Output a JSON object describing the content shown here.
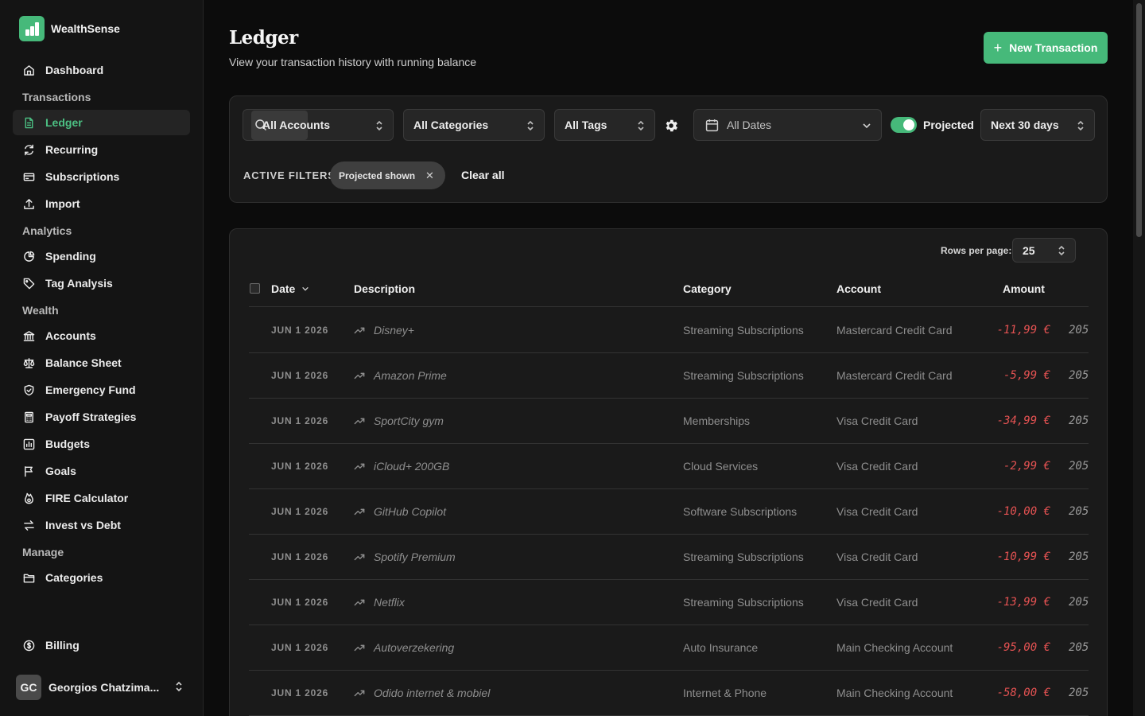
{
  "app": {
    "name": "WealthSense"
  },
  "sidebar": {
    "items": [
      {
        "type": "item",
        "label": "Dashboard",
        "icon": "home-icon"
      },
      {
        "type": "section",
        "label": "Transactions"
      },
      {
        "type": "item",
        "label": "Ledger",
        "icon": "file-text-icon",
        "active": true
      },
      {
        "type": "item",
        "label": "Recurring",
        "icon": "refresh-icon"
      },
      {
        "type": "item",
        "label": "Subscriptions",
        "icon": "credit-card-icon"
      },
      {
        "type": "item",
        "label": "Import",
        "icon": "upload-icon"
      },
      {
        "type": "section",
        "label": "Analytics"
      },
      {
        "type": "item",
        "label": "Spending",
        "icon": "pie-chart-icon"
      },
      {
        "type": "item",
        "label": "Tag Analysis",
        "icon": "tag-icon"
      },
      {
        "type": "section",
        "label": "Wealth"
      },
      {
        "type": "item",
        "label": "Accounts",
        "icon": "bank-icon"
      },
      {
        "type": "item",
        "label": "Balance Sheet",
        "icon": "scale-icon"
      },
      {
        "type": "item",
        "label": "Emergency Fund",
        "icon": "shield-icon"
      },
      {
        "type": "item",
        "label": "Payoff Strategies",
        "icon": "calculator-icon"
      },
      {
        "type": "item",
        "label": "Budgets",
        "icon": "chart-box-icon"
      },
      {
        "type": "item",
        "label": "Goals",
        "icon": "flag-icon"
      },
      {
        "type": "item",
        "label": "FIRE Calculator",
        "icon": "flame-icon"
      },
      {
        "type": "item",
        "label": "Invest vs Debt",
        "icon": "arrows-swap-icon"
      },
      {
        "type": "section",
        "label": "Manage"
      },
      {
        "type": "item",
        "label": "Categories",
        "icon": "folder-icon"
      }
    ],
    "billing": "Billing",
    "user": {
      "initials": "GC",
      "name": "Georgios Chatzima..."
    }
  },
  "page": {
    "title": "Ledger",
    "subtitle": "View your transaction history with running balance",
    "new_button": "New Transaction"
  },
  "filters": {
    "accounts": "All Accounts",
    "categories": "All Categories",
    "tags": "All Tags",
    "dates": "All Dates",
    "projected_label": "Projected",
    "projected_on": true,
    "range": "Next 30 days",
    "active_label": "ACTIVE FILTERS:",
    "chip": "Projected shown",
    "clear": "Clear all"
  },
  "table": {
    "rows_per_page_label": "Rows per page:",
    "rows_per_page": "25",
    "headers": {
      "date": "Date",
      "description": "Description",
      "category": "Category",
      "account": "Account",
      "amount": "Amount"
    },
    "rows": [
      {
        "date": "JUN 1 2026",
        "description": "Disney+",
        "category": "Streaming Subscriptions",
        "account": "Mastercard Credit Card",
        "amount": "-11,99 €",
        "balance": "205"
      },
      {
        "date": "JUN 1 2026",
        "description": "Amazon Prime",
        "category": "Streaming Subscriptions",
        "account": "Mastercard Credit Card",
        "amount": "-5,99 €",
        "balance": "205"
      },
      {
        "date": "JUN 1 2026",
        "description": "SportCity gym",
        "category": "Memberships",
        "account": "Visa Credit Card",
        "amount": "-34,99 €",
        "balance": "205"
      },
      {
        "date": "JUN 1 2026",
        "description": "iCloud+ 200GB",
        "category": "Cloud Services",
        "account": "Visa Credit Card",
        "amount": "-2,99 €",
        "balance": "205"
      },
      {
        "date": "JUN 1 2026",
        "description": "GitHub Copilot",
        "category": "Software Subscriptions",
        "account": "Visa Credit Card",
        "amount": "-10,00 €",
        "balance": "205"
      },
      {
        "date": "JUN 1 2026",
        "description": "Spotify Premium",
        "category": "Streaming Subscriptions",
        "account": "Visa Credit Card",
        "amount": "-10,99 €",
        "balance": "205"
      },
      {
        "date": "JUN 1 2026",
        "description": "Netflix",
        "category": "Streaming Subscriptions",
        "account": "Visa Credit Card",
        "amount": "-13,99 €",
        "balance": "205"
      },
      {
        "date": "JUN 1 2026",
        "description": "Autoverzekering",
        "category": "Auto Insurance",
        "account": "Main Checking Account",
        "amount": "-95,00 €",
        "balance": "205"
      },
      {
        "date": "JUN 1 2026",
        "description": "Odido internet & mobiel",
        "category": "Internet & Phone",
        "account": "Main Checking Account",
        "amount": "-58,00 €",
        "balance": "205"
      }
    ]
  },
  "colors": {
    "accent": "#46b97a",
    "negative": "#e45252",
    "background": "#0c0c0c"
  }
}
